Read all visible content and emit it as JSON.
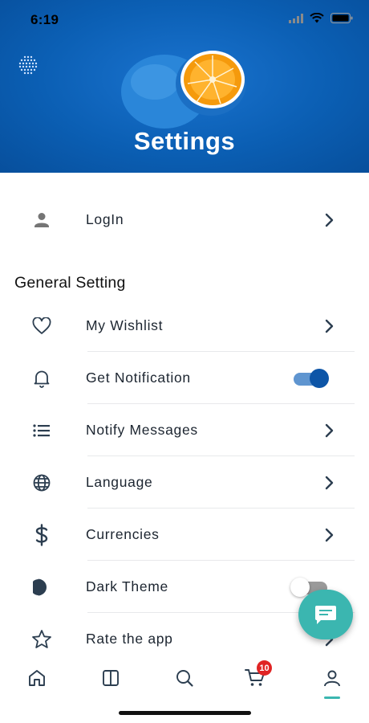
{
  "status": {
    "time": "6:19"
  },
  "header": {
    "title": "Settings"
  },
  "login": {
    "label": "LogIn"
  },
  "general": {
    "section_title": "General Setting",
    "items": [
      {
        "label": "My Wishlist",
        "icon": "heart-icon",
        "control": "chevron"
      },
      {
        "label": "Get Notification",
        "icon": "bell-icon",
        "control": "toggle",
        "toggle_on": true
      },
      {
        "label": "Notify Messages",
        "icon": "list-icon",
        "control": "chevron"
      },
      {
        "label": "Language",
        "icon": "globe-icon",
        "control": "chevron"
      },
      {
        "label": "Currencies",
        "icon": "dollar-icon",
        "control": "chevron"
      },
      {
        "label": "Dark Theme",
        "icon": "moon-icon",
        "control": "toggle",
        "toggle_on": false
      },
      {
        "label": "Rate the app",
        "icon": "star-icon",
        "control": "chevron"
      }
    ]
  },
  "tabbar": {
    "tabs": [
      {
        "icon": "home-icon"
      },
      {
        "icon": "categories-icon"
      },
      {
        "icon": "search-icon"
      },
      {
        "icon": "cart-icon"
      },
      {
        "icon": "profile-icon",
        "active": true
      }
    ],
    "cart_badge": "10"
  },
  "colors": {
    "header_blue": "#0b5fb4",
    "accent_teal": "#3bb6b0",
    "toggle_on": "#0d55a7",
    "badge_red": "#e02424"
  }
}
